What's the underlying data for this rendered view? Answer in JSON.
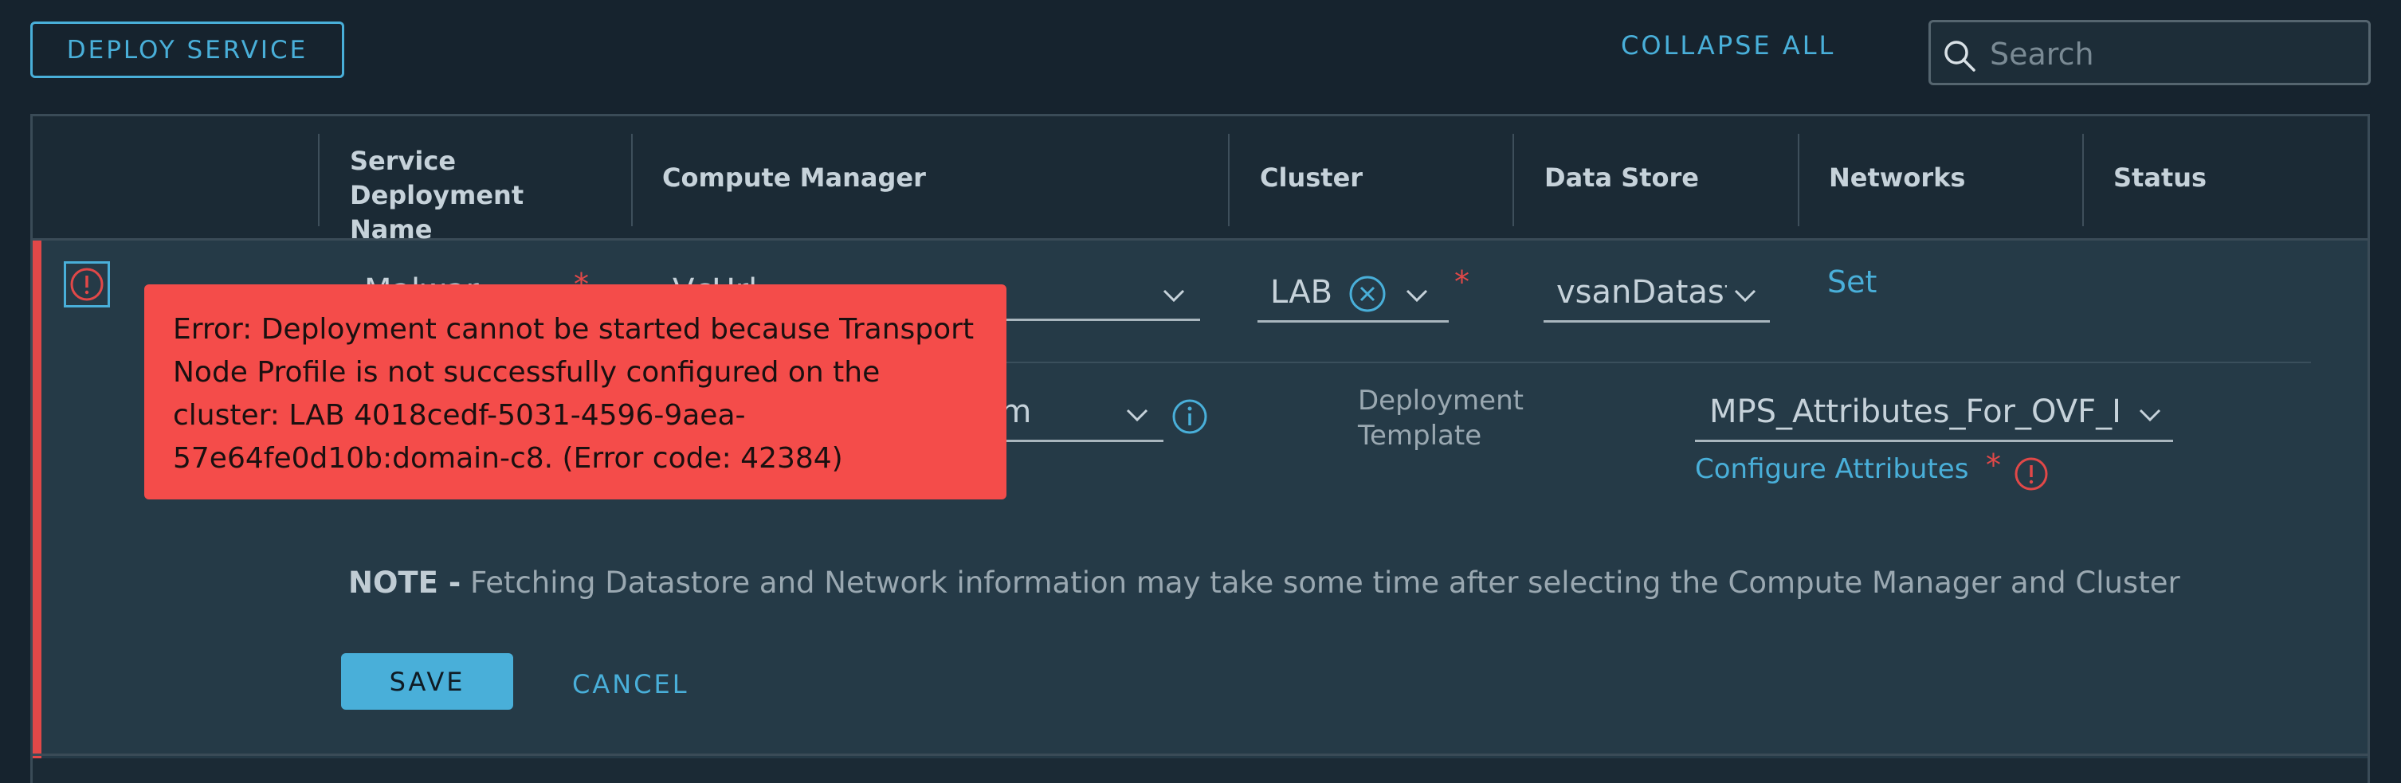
{
  "toolbar": {
    "deploy_label": "DEPLOY SERVICE",
    "collapse_label": "COLLAPSE ALL",
    "search_placeholder": "Search"
  },
  "table": {
    "headers": [
      "Service Deployment Name",
      "Compute Manager",
      "Cluster",
      "Data Store",
      "Networks",
      "Status"
    ]
  },
  "row": {
    "name_value": "Malwar",
    "compute_manager_value": "VcUrl",
    "cluster_value": "LAB",
    "datastore_value": "vsanDatast",
    "networks_link": "Set",
    "deployment_spec_value": "um",
    "deployment_template_label": "Deployment Template",
    "deployment_template_value": "MPS_Attributes_For_OVF_I",
    "configure_attributes_link": "Configure Attributes",
    "required_mark": "*"
  },
  "error": {
    "message": "Error: Deployment cannot be started because Transport Node Profile is not successfully configured on the cluster: LAB 4018cedf-5031-4596-9aea-57e64fe0d10b:domain-c8. (Error code: 42384)"
  },
  "note": {
    "prefix": "NOTE -",
    "text": "Fetching Datastore and Network information may take some time after selecting the Compute Manager and Cluster"
  },
  "actions": {
    "save_label": "SAVE",
    "cancel_label": "CANCEL"
  },
  "colors": {
    "accent": "#49afd9",
    "error": "#f44c4a",
    "background": "#16232e"
  }
}
